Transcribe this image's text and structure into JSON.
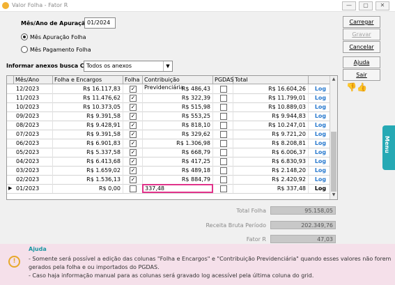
{
  "window": {
    "title": "Valor Folha - Fator R",
    "min": "—",
    "max": "▢",
    "close": "✕"
  },
  "form": {
    "mes_ano_label": "Mês/Ano de Apuração",
    "mes_ano_value": "01/2024",
    "radio_folha": "Mês Apuração Folha",
    "radio_pagamento": "Mês Pagamento Folha",
    "anexos_label": "Informar anexos busca CPP",
    "anexos_value": "Todos os anexos"
  },
  "buttons": {
    "carregar": "Carregar",
    "gravar": "Gravar",
    "cancelar": "Cancelar",
    "ajuda": "Ajuda",
    "sair": "Sair"
  },
  "feedback_icons": "👎👍",
  "menu_tab": "Menu",
  "grid": {
    "columns": [
      "Mês/Ano",
      "Folha e Encargos",
      "Folha",
      "Contribuição Previdenciária",
      "PGDAS",
      "Total"
    ],
    "log_label": "Log",
    "rows": [
      {
        "mes": "12/2023",
        "folha_encargos": "R$ 16.117,83",
        "folha": true,
        "contrib": "R$ 486,43",
        "pgdas": false,
        "total": "R$ 16.604,26"
      },
      {
        "mes": "11/2023",
        "folha_encargos": "R$ 11.476,62",
        "folha": true,
        "contrib": "R$ 322,39",
        "pgdas": false,
        "total": "R$ 11.799,01"
      },
      {
        "mes": "10/2023",
        "folha_encargos": "R$ 10.373,05",
        "folha": true,
        "contrib": "R$ 515,98",
        "pgdas": false,
        "total": "R$ 10.889,03"
      },
      {
        "mes": "09/2023",
        "folha_encargos": "R$ 9.391,58",
        "folha": true,
        "contrib": "R$ 553,25",
        "pgdas": false,
        "total": "R$ 9.944,83"
      },
      {
        "mes": "08/2023",
        "folha_encargos": "R$ 9.428,91",
        "folha": true,
        "contrib": "R$ 818,10",
        "pgdas": false,
        "total": "R$ 10.247,01"
      },
      {
        "mes": "07/2023",
        "folha_encargos": "R$ 9.391,58",
        "folha": true,
        "contrib": "R$ 329,62",
        "pgdas": false,
        "total": "R$ 9.721,20"
      },
      {
        "mes": "06/2023",
        "folha_encargos": "R$ 6.901,83",
        "folha": true,
        "contrib": "R$ 1.306,98",
        "pgdas": false,
        "total": "R$ 8.208,81"
      },
      {
        "mes": "05/2023",
        "folha_encargos": "R$ 5.337,58",
        "folha": true,
        "contrib": "R$ 668,79",
        "pgdas": false,
        "total": "R$ 6.006,37"
      },
      {
        "mes": "04/2023",
        "folha_encargos": "R$ 6.413,68",
        "folha": true,
        "contrib": "R$ 417,25",
        "pgdas": false,
        "total": "R$ 6.830,93"
      },
      {
        "mes": "03/2023",
        "folha_encargos": "R$ 1.659,02",
        "folha": true,
        "contrib": "R$ 489,18",
        "pgdas": false,
        "total": "R$ 2.148,20"
      },
      {
        "mes": "02/2023",
        "folha_encargos": "R$ 1.536,13",
        "folha": true,
        "contrib": "R$ 884,79",
        "pgdas": false,
        "total": "R$ 2.420,92"
      },
      {
        "mes": "01/2023",
        "folha_encargos": "R$ 0,00",
        "folha": false,
        "contrib": "337,48",
        "pgdas": false,
        "total": "R$ 337,48",
        "current": true,
        "editing": true
      }
    ]
  },
  "totals": {
    "total_folha_label": "Total Folha",
    "total_folha_value": "95.158,05",
    "receita_label": "Receita Bruta Período",
    "receita_value": "202.349,76",
    "fator_label": "Fator R",
    "fator_value": "47,03"
  },
  "help": {
    "title": "Ajuda",
    "line1": "- Somente será possível a edição das colunas \"Folha e Encargos\" e \"Contribuição Previdenciária\" quando esses valores não forem",
    "line2": "gerados pela folha e ou importados do PGDAS.",
    "line3": "- Caso haja informação manual para as colunas será gravado log acessível pela última coluna do grid."
  },
  "colors": {
    "accent_pink": "#e0338a",
    "menu_teal": "#26a9b4",
    "log_blue": "#2b7bcf",
    "help_bg": "#f5e0ea"
  }
}
